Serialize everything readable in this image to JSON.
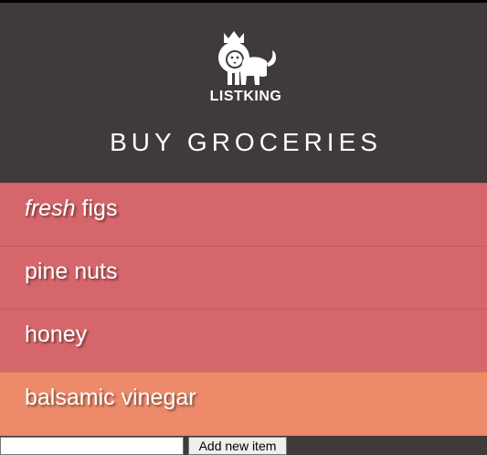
{
  "header": {
    "logo_icon": "crowned-lion-icon",
    "brand": "LISTKING",
    "title": "BUY GROCERIES"
  },
  "list": {
    "items": [
      {
        "emphasis": "fresh",
        "label": " figs"
      },
      {
        "emphasis": "",
        "label": "pine nuts"
      },
      {
        "emphasis": "",
        "label": "honey"
      },
      {
        "emphasis": "",
        "label": "balsamic vinegar"
      }
    ]
  },
  "add_form": {
    "input_value": "",
    "button_label": "Add new item"
  },
  "colors": {
    "background": "#403b3a",
    "item": "#d5666b",
    "item_highlight": "#ec8a69",
    "text": "#ffffff"
  }
}
